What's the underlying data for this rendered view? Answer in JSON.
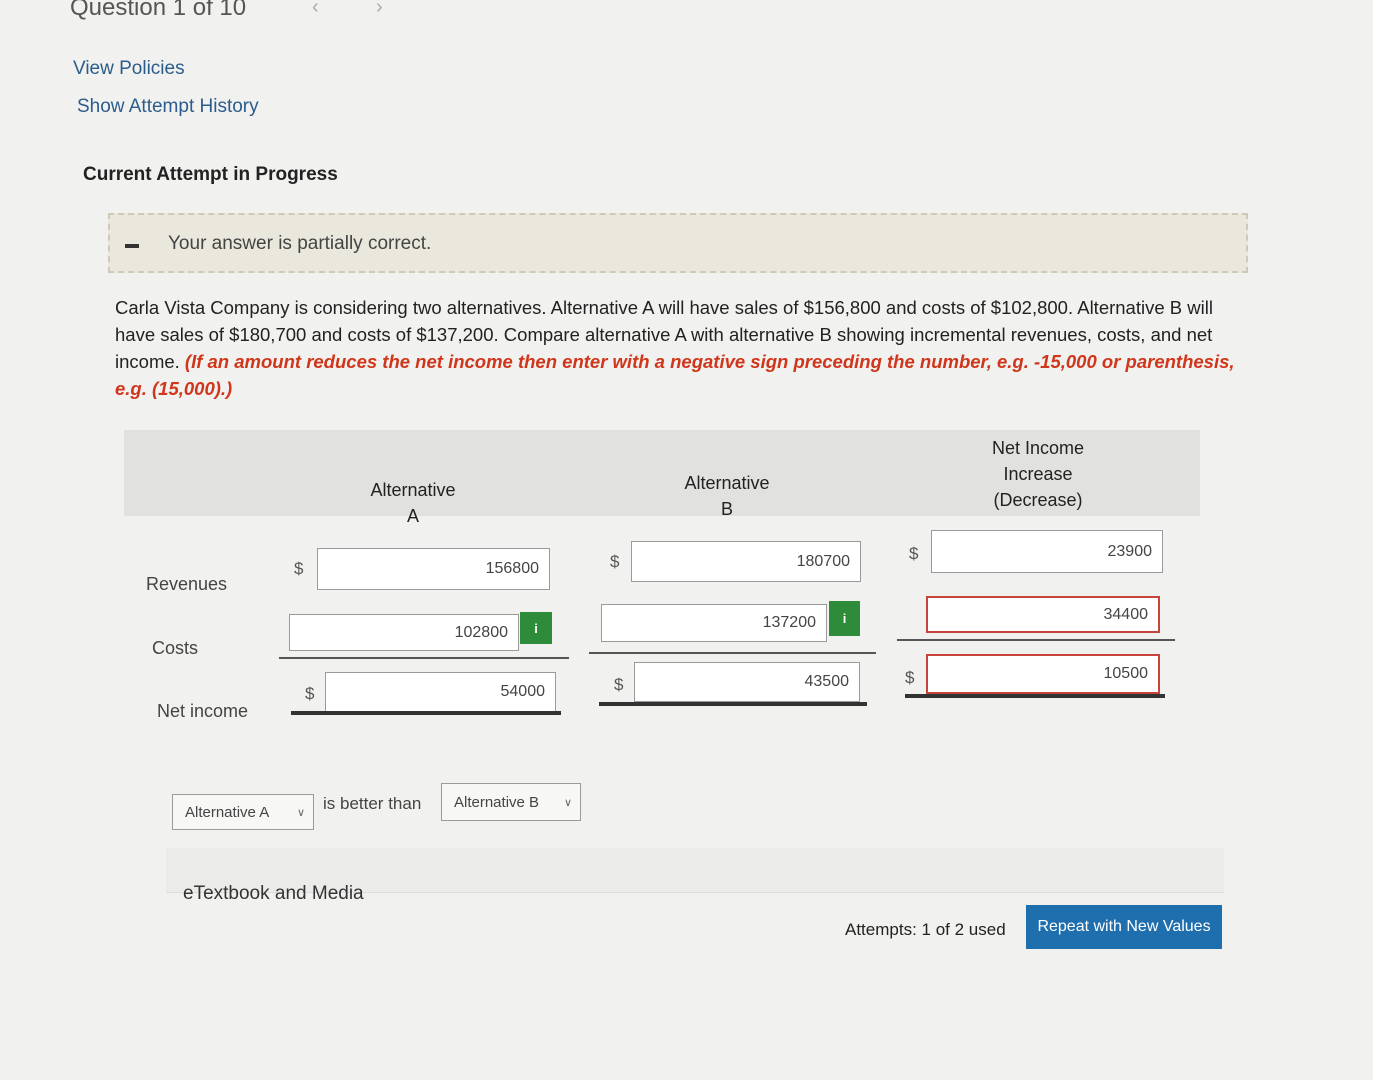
{
  "header": {
    "question_label": "Question 1 of 10",
    "prev_symbol": "‹",
    "next_symbol": "›",
    "view_policies": "View Policies",
    "show_attempt_history": "Show Attempt History"
  },
  "attempt": {
    "caption": "Current Attempt in Progress",
    "feedback": "Your answer is partially correct."
  },
  "problem": {
    "text": "Carla Vista Company is considering two alternatives. Alternative A will have sales of $156,800 and costs of $102,800. Alternative B will have sales of $180,700 and costs of $137,200. Compare alternative A with alternative B showing incremental revenues, costs, and net income. ",
    "instruction": "(If an amount reduces the net income then enter with a negative sign preceding the number, e.g. -15,000 or parenthesis, e.g. (15,000).)"
  },
  "table": {
    "col_a": [
      "Alternative",
      "A"
    ],
    "col_b": [
      "Alternative",
      "B"
    ],
    "col_net": [
      "Net Income",
      "Increase",
      "(Decrease)"
    ],
    "currency": "$",
    "rows": {
      "revenues": {
        "label": "Revenues",
        "a": "156800",
        "b": "180700",
        "net": "23900"
      },
      "costs": {
        "label": "Costs",
        "a": "102800",
        "b": "137200",
        "net": "34400"
      },
      "net_income": {
        "label": "Net income",
        "a": "54000",
        "b": "43500",
        "net": "10500"
      }
    },
    "info_symbol": "i"
  },
  "comparison": {
    "left_select": "Alternative A",
    "connector": "is better than",
    "right_select": "Alternative B"
  },
  "footer": {
    "etextbook": "eTextbook and Media",
    "attempts": "Attempts: 1 of 2 used",
    "repeat_button": "Repeat with New Values"
  },
  "colors": {
    "link": "#2c5c8c",
    "instruction": "#d0361b",
    "info_badge": "#2e8b3a",
    "incorrect_border": "#c8443a",
    "button": "#1f6fae"
  }
}
